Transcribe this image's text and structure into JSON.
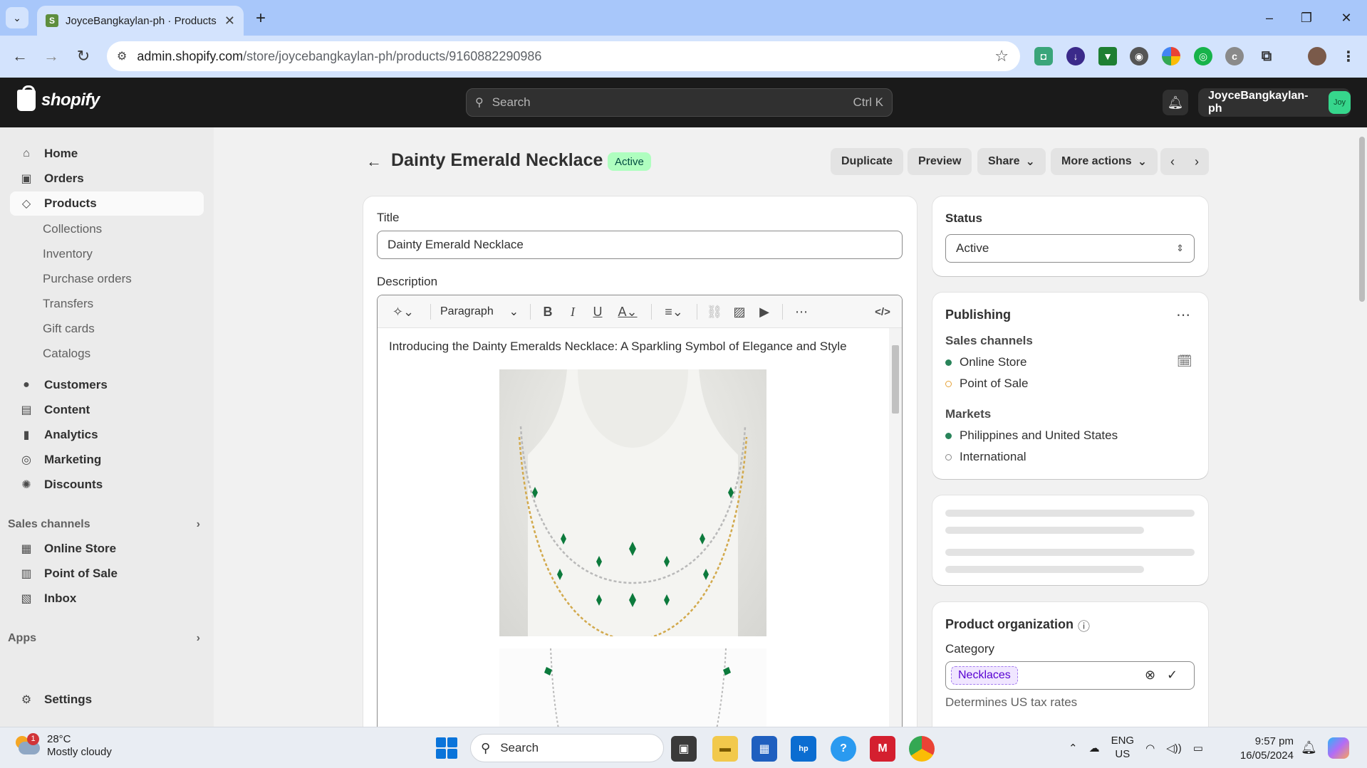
{
  "browser": {
    "tab_title": "JoyceBangkaylan-ph · Products",
    "url_host": "admin.shopify.com",
    "url_path": "/store/joycebangkaylan-ph/products/9160882290986"
  },
  "topbar": {
    "brand": "shopify",
    "search_placeholder": "Search",
    "search_shortcut": "Ctrl K",
    "store_name": "JoyceBangkaylan-ph",
    "store_avatar": "Joy"
  },
  "sidebar": {
    "items": [
      {
        "label": "Home",
        "icon": "home-icon"
      },
      {
        "label": "Orders",
        "icon": "inbox-tray-icon"
      },
      {
        "label": "Products",
        "icon": "tag-icon"
      }
    ],
    "product_sub": [
      "Collections",
      "Inventory",
      "Purchase orders",
      "Transfers",
      "Gift cards",
      "Catalogs"
    ],
    "items2": [
      {
        "label": "Customers",
        "icon": "person-icon"
      },
      {
        "label": "Content",
        "icon": "content-icon"
      },
      {
        "label": "Analytics",
        "icon": "bar-chart-icon"
      },
      {
        "label": "Marketing",
        "icon": "target-icon"
      },
      {
        "label": "Discounts",
        "icon": "discount-icon"
      }
    ],
    "sales_channels_heading": "Sales channels",
    "channels": [
      {
        "label": "Online Store",
        "icon": "store-icon"
      },
      {
        "label": "Point of Sale",
        "icon": "pos-icon"
      },
      {
        "label": "Inbox",
        "icon": "inbox-icon"
      }
    ],
    "apps_heading": "Apps",
    "settings_label": "Settings"
  },
  "page": {
    "title": "Dainty Emerald Necklace",
    "status_badge": "Active",
    "actions": {
      "duplicate": "Duplicate",
      "preview": "Preview",
      "share": "Share",
      "more": "More actions"
    }
  },
  "product_form": {
    "title_label": "Title",
    "title_value": "Dainty Emerald Necklace",
    "description_label": "Description",
    "paragraph_format": "Paragraph",
    "description_intro": "Introducing the Dainty Emeralds Necklace: A Sparkling Symbol of Elegance and Style"
  },
  "status_card": {
    "label": "Status",
    "value": "Active"
  },
  "publishing": {
    "title": "Publishing",
    "sales_channels_label": "Sales channels",
    "channels": [
      {
        "name": "Online Store",
        "state": "on"
      },
      {
        "name": "Point of Sale",
        "state": "off"
      }
    ],
    "markets_label": "Markets",
    "markets": [
      {
        "name": "Philippines and United States",
        "state": "on"
      },
      {
        "name": "International",
        "state": "off"
      }
    ]
  },
  "organization": {
    "title": "Product organization",
    "category_label": "Category",
    "category_value": "Necklaces",
    "category_help": "Determines US tax rates"
  },
  "taskbar": {
    "weather_temp": "28°C",
    "weather_cond": "Mostly cloudy",
    "weather_badge": "1",
    "search_label": "Search",
    "lang_line1": "ENG",
    "lang_line2": "US",
    "time": "9:57 pm",
    "date": "16/05/2024"
  },
  "colors": {
    "active_badge_bg": "#affebf",
    "published_dot": "#29845a",
    "pos_dot": "#e6a33a",
    "topbar_bg": "#1a1a1a"
  }
}
